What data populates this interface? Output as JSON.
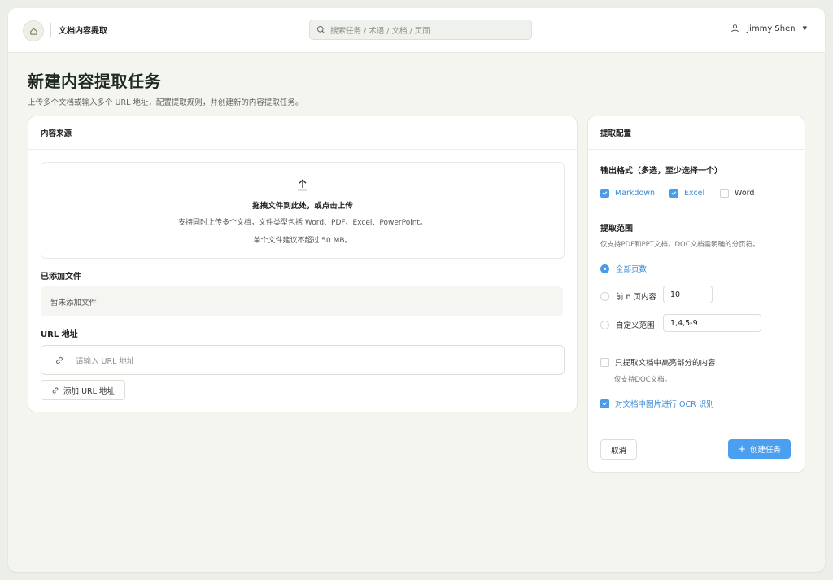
{
  "header": {
    "app_title": "文档内容提取",
    "search_placeholder": "搜索任务 / 术语 / 文档 / 页面",
    "user_name": "Jimmy Shen",
    "caret": "▼"
  },
  "page": {
    "title": "新建内容提取任务",
    "subtitle": "上传多个文档或输入多个 URL 地址，配置提取规则，并创建新的内容提取任务。"
  },
  "source": {
    "card_title": "内容来源",
    "dropzone": {
      "title": "拖拽文件到此处，或点击上传",
      "line1": "支持同时上传多个文档，文件类型包括 Word、PDF、Excel、PowerPoint。",
      "line2": "单个文件建议不超过 50 MB。"
    },
    "files_label": "已添加文件",
    "files_empty": "暂未添加文件",
    "url_label": "URL 地址",
    "url_placeholder": "请输入 URL 地址",
    "add_url_button": "添加 URL 地址"
  },
  "config": {
    "card_title": "提取配置",
    "format_heading": "输出格式（多选，至少选择一个）",
    "formats": [
      {
        "label": "Markdown",
        "checked": true
      },
      {
        "label": "Excel",
        "checked": true
      },
      {
        "label": "Word",
        "checked": false
      }
    ],
    "range_heading": "提取范围",
    "range_note": "仅支持PDF和PPT文档，DOC文档需明确的分页符。",
    "range_options": [
      {
        "label": "全部页数",
        "selected": true
      },
      {
        "label": "前 n 页内容",
        "selected": false,
        "value": "10"
      },
      {
        "label": "自定义范围",
        "selected": false,
        "value": "1,4,5-9"
      }
    ],
    "highlight_option": {
      "label": "只提取文档中高亮部分的内容",
      "checked": false,
      "note": "仅支持DOC文档。"
    },
    "ocr_option": {
      "label": "对文档中图片进行 OCR 识别",
      "checked": true
    },
    "cancel_button": "取消",
    "create_button": "创建任务",
    "create_plus": "+"
  },
  "colors": {
    "accent": "#4a9ff0",
    "checked_text": "#3b8ad6",
    "background": "#f5f5f0"
  },
  "icons": [
    "home-icon",
    "search-icon",
    "user-icon",
    "upload-icon",
    "link-icon",
    "plus-icon"
  ]
}
